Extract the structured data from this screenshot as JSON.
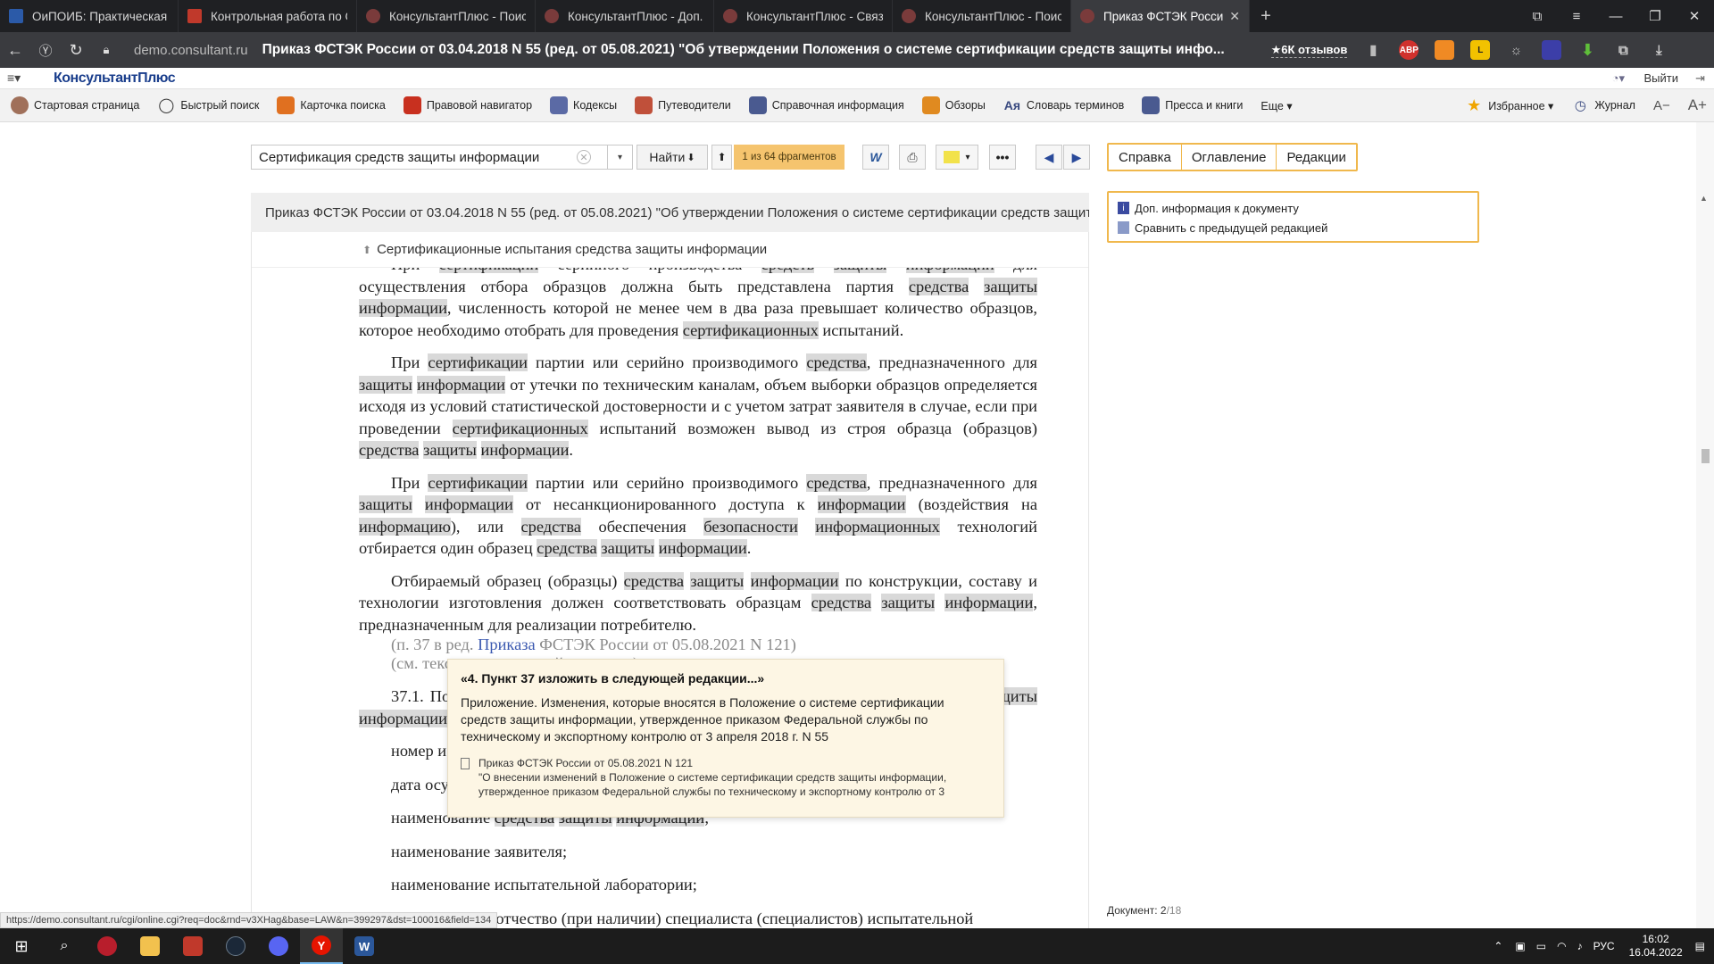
{
  "browser": {
    "tabs": [
      {
        "label": "ОиПОИБ: Практическая р",
        "color": "#2b5aa8"
      },
      {
        "label": "Контрольная работа по С",
        "color": "#c0392b"
      },
      {
        "label": "КонсультантПлюс - Поис",
        "color": "#7a3b3b"
      },
      {
        "label": "КонсультантПлюс - Доп. и",
        "color": "#7a3b3b"
      },
      {
        "label": "КонсультантПлюс - Связ",
        "color": "#7a3b3b"
      },
      {
        "label": "КонсультантПлюс - Поис",
        "color": "#7a3b3b"
      },
      {
        "label": "Приказ ФСТЭК России",
        "color": "#7a3b3b",
        "active": true
      }
    ],
    "domain": "demo.consultant.ru",
    "page_title": "Приказ ФСТЭК России от 03.04.2018 N 55 (ред. от 05.08.2021) \"Об утверждении Положения о системе сертификации средств защиты инфо...",
    "reviews": "★6К отзывов",
    "ext_abp": "ABP"
  },
  "header": {
    "logo": "КонсультантПлюс",
    "exit": "Выйти"
  },
  "toolbar": {
    "items": [
      {
        "label": "Стартовая страница",
        "icon": "home-avatar-icon"
      },
      {
        "label": "Быстрый поиск",
        "icon": "magnifier-icon"
      },
      {
        "label": "Карточка поиска",
        "icon": "search-card-icon"
      },
      {
        "label": "Правовой навигатор",
        "icon": "navigator-icon"
      },
      {
        "label": "Кодексы",
        "icon": "book-icon"
      },
      {
        "label": "Путеводители",
        "icon": "signpost-icon"
      },
      {
        "label": "Справочная информация",
        "icon": "reference-icon"
      },
      {
        "label": "Обзоры",
        "icon": "pen-icon"
      },
      {
        "label": "Словарь терминов",
        "icon": "dictionary-icon"
      },
      {
        "label": "Пресса и книги",
        "icon": "newspaper-icon"
      },
      {
        "label": "Еще ▾",
        "icon": ""
      }
    ],
    "favorites": "Избранное ▾",
    "journal": "Журнал",
    "font_minus": "A−",
    "font_plus": "A+"
  },
  "search": {
    "value": "Сертификация средств защиты информации",
    "find_label": "Найти",
    "fragments": "1 из 64 фрагментов"
  },
  "side_tabs": [
    "Справка",
    "Оглавление",
    "Редакции"
  ],
  "document": {
    "title": "Приказ ФСТЭК России от 03.04.2018 N 55 (ред. от 05.08.2021) \"Об утверждении Положения о системе сертификации средств защиты",
    "section_link": "Сертификационные испытания средства защиты информации"
  },
  "tooltip": {
    "heading": "«4. Пункт 37 изложить в следующей редакции...»",
    "body": "Приложение. Изменения, которые вносятся в Положение о системе сертификации средств защиты информации, утвержденное приказом Федеральной службы по техническому и экспортному контролю от 3 апреля 2018 г. N 55",
    "ref_title": "Приказ ФСТЭК России от 05.08.2021 N 121",
    "ref_text": "\"О внесении изменений в Положение о системе сертификации средств защиты информации, утвержденное приказом Федеральной службы по техническому и экспортному контролю от 3"
  },
  "info_panel": {
    "extra_info": "Доп. информация к документу",
    "compare": "Сравнить с предыдущей редакцией"
  },
  "doc_count": {
    "label": "Документ: 2",
    "total": "/18"
  },
  "status_url": "https://demo.consultant.ru/cgi/online.cgi?req=doc&rnd=v3XHag&base=LAW&n=399297&dst=100016&field=134",
  "taskbar": {
    "lang": "РУС",
    "time": "16:02",
    "date": "16.04.2022"
  }
}
